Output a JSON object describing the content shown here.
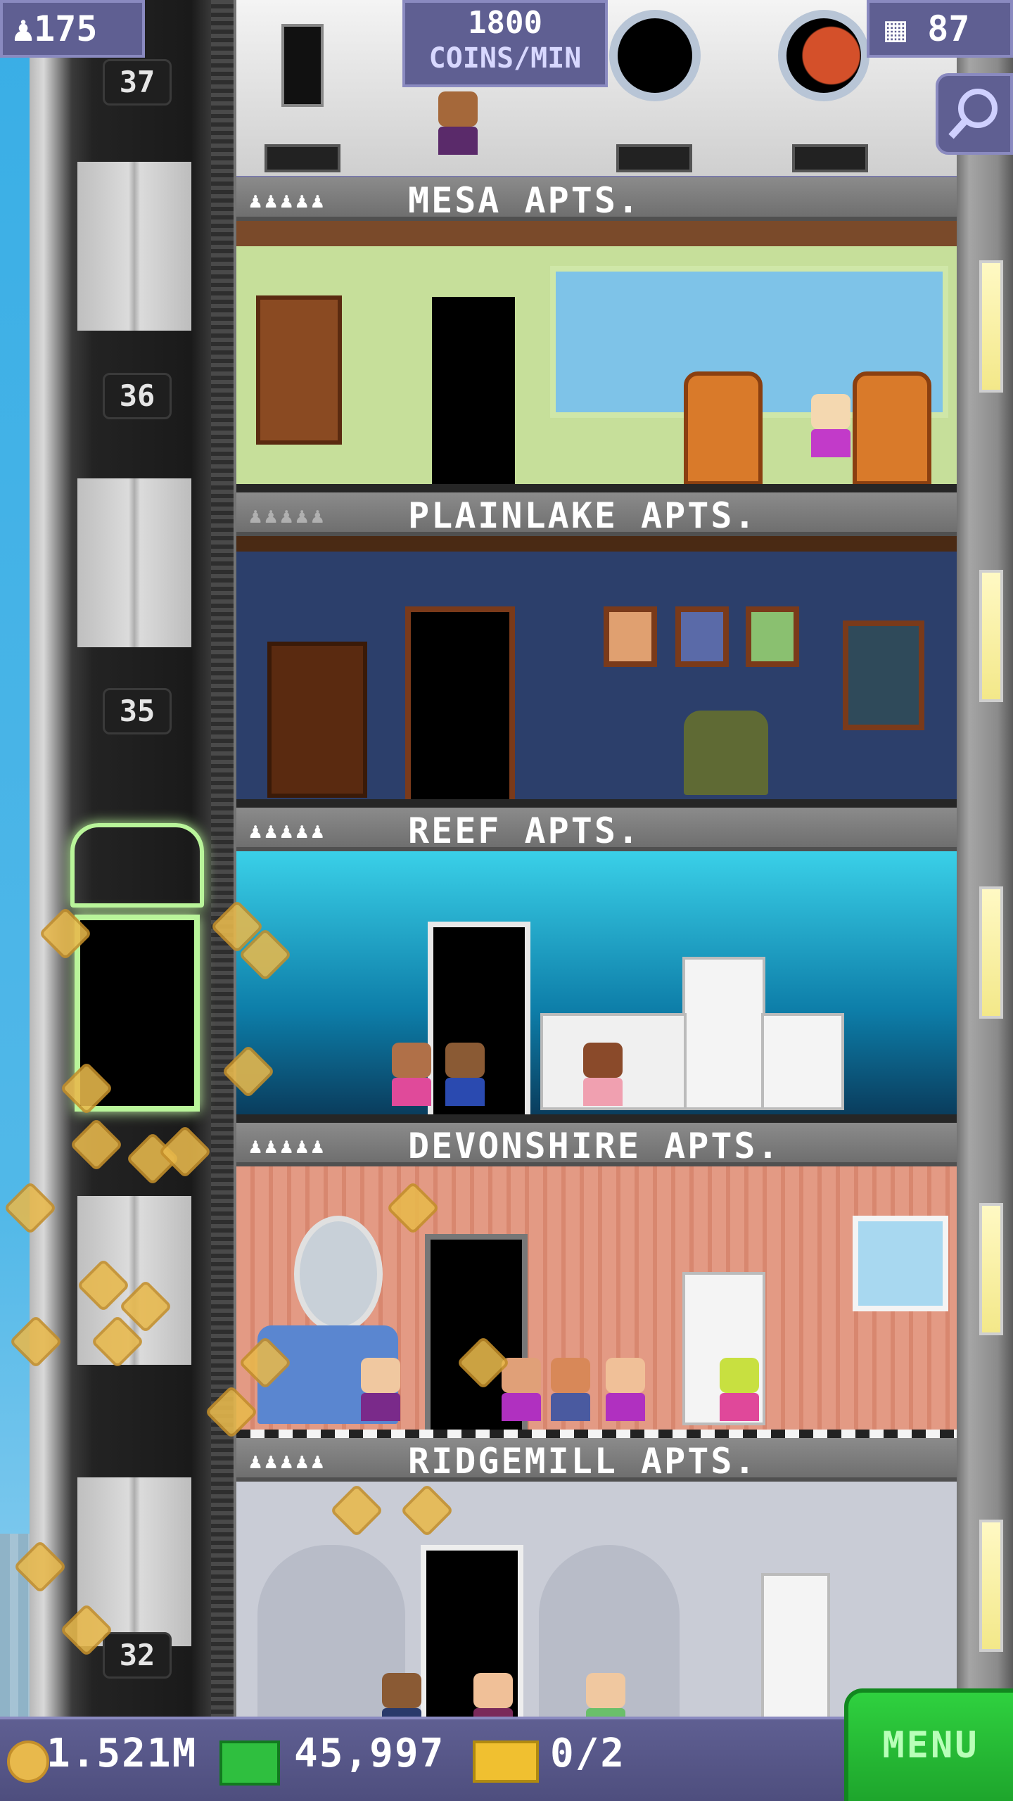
{
  "hud": {
    "population": "175",
    "rate_value": "1800",
    "rate_unit": "COINS/MIN",
    "floor_count": "87"
  },
  "shaft_floor_numbers": [
    "37",
    "36",
    "35",
    "32"
  ],
  "floors": [
    {
      "name": "MESA APTS.",
      "residents": "♟♟♟♟♟",
      "theme": "#c6df9a"
    },
    {
      "name": "PLAINLAKE APTS.",
      "residents": "♟♟♟♟♟",
      "theme": "#2c3f6b"
    },
    {
      "name": "REEF APTS.",
      "residents": "♟♟♟♟♟",
      "theme": "#1fb6d8"
    },
    {
      "name": "DEVONSHIRE APTS.",
      "residents": "♟♟♟♟♟",
      "theme": "#e39a84"
    },
    {
      "name": "RIDGEMILL APTS.",
      "residents": "♟♟♟♟♟",
      "theme": "#c9ccd6"
    }
  ],
  "bottom_bar": {
    "coins": "1.521M",
    "bux": "45,997",
    "tickets": "0/2",
    "menu_label": "MENU"
  },
  "icons": [
    "person-icon",
    "building-icon",
    "magnifier-icon",
    "coin-icon",
    "bux-icon",
    "ticket-icon"
  ],
  "colors": {
    "hud_bg": "#5f5f92",
    "menu_green": "#2fd13f",
    "coin_gold": "#e8b94c"
  }
}
